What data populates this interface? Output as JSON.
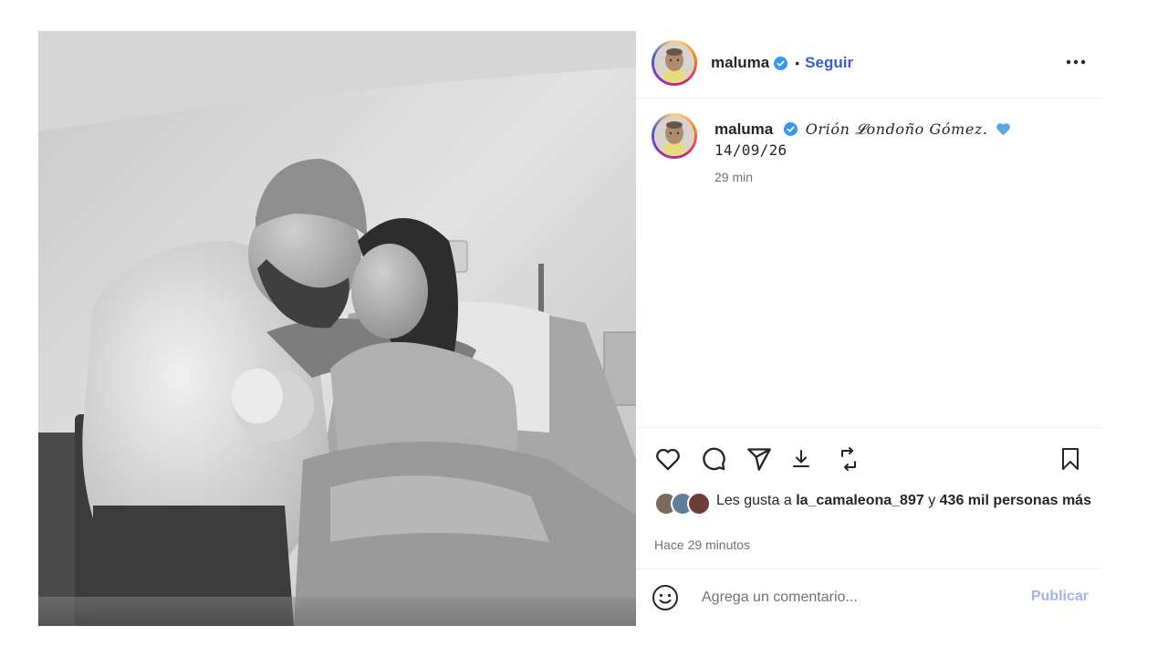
{
  "post": {
    "author": {
      "username": "maluma",
      "verified": true,
      "avatar_icon": "child-portrait-avatar"
    },
    "header": {
      "separator_dot": "•",
      "follow_label": "Seguir",
      "more_icon": "more-horizontal-icon"
    },
    "photo": {
      "description_icon": "black-and-white-hospital-photo"
    },
    "caption": {
      "username": "maluma",
      "text": "𝑂𝑟𝑖𝑜́𝑛 𝓛𝑜𝑛𝑑𝑜𝑛̃𝑜 𝐺𝑜́𝑚𝑒𝑧.",
      "emoji": "blue-heart-emoji",
      "date": "14/09/26",
      "time_ago": "29 min"
    },
    "actions": {
      "like_icon": "heart-icon",
      "comment_icon": "comment-icon",
      "share_icon": "send-icon",
      "download_icon": "download-icon",
      "repost_icon": "repost-icon",
      "save_icon": "bookmark-icon"
    },
    "likes": {
      "prefix": "Les gusta a",
      "first_user": "la_camaleona_897",
      "connector": "y",
      "others": "436 mil personas",
      "suffix": "más"
    },
    "timestamp": "Hace 29 minutos",
    "comment": {
      "placeholder": "Agrega un comentario...",
      "publish_label": "Publicar",
      "emoji_icon": "smiley-icon"
    }
  },
  "colors": {
    "accent": "#3b5bd6",
    "verified": "#3897f0",
    "publish_disabled": "#a5b4ec",
    "muted_text": "#737373",
    "divider": "#efefef"
  }
}
